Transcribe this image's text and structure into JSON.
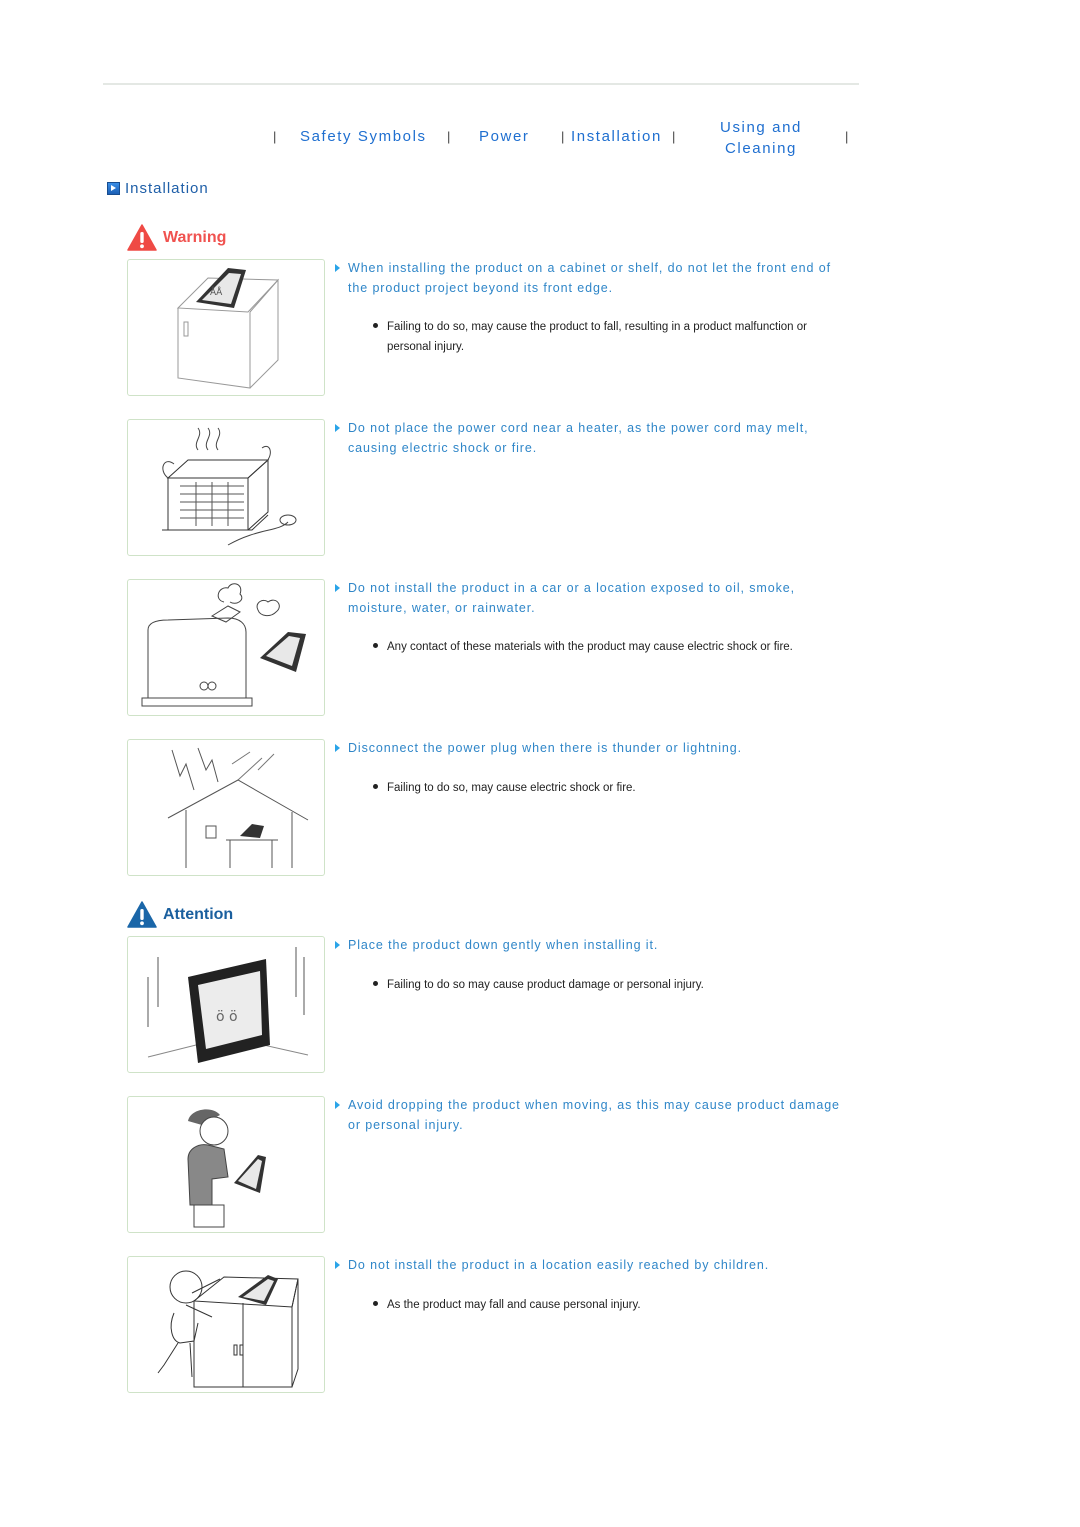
{
  "nav": {
    "items": [
      {
        "label": "Safety Symbols"
      },
      {
        "label": "Power"
      },
      {
        "label": "Installation"
      },
      {
        "label_line1": "Using and",
        "label_line2": "Cleaning"
      }
    ],
    "separator": "|"
  },
  "section": {
    "title": "Installation"
  },
  "warning": {
    "label": "Warning",
    "items": [
      {
        "heading": "When installing the product on a cabinet or shelf, do not let the front end of the product project beyond its front edge.",
        "bullet": "Failing to do so, may cause the product to fall, resulting in a product malfunction or personal injury.",
        "illustration": "photo-frame-on-cabinet-edge"
      },
      {
        "heading": "Do not place the power cord near a heater, as the power cord may melt, causing electric shock or fire.",
        "bullet": null,
        "illustration": "heater-with-power-cord"
      },
      {
        "heading": "Do not install the product in a car or a location exposed to oil, smoke, moisture, water, or rainwater.",
        "bullet": "Any contact of these materials with the product may cause electric shock or fire.",
        "illustration": "humidifier-steam-near-frame"
      },
      {
        "heading": "Disconnect the power plug when there is thunder or lightning.",
        "bullet": "Failing to do so, may cause electric shock or fire.",
        "illustration": "lightning-over-house"
      }
    ]
  },
  "attention": {
    "label": "Attention",
    "items": [
      {
        "heading": "Place the product down gently when installing it.",
        "bullet": "Failing to do so may cause product damage or personal injury.",
        "illustration": "frame-dropped-impact"
      },
      {
        "heading": "Avoid dropping the product when moving, as this may cause product damage or personal injury.",
        "bullet": null,
        "illustration": "person-carrying-frame"
      },
      {
        "heading": "Do not install the product in a location easily reached by children.",
        "bullet": "As the product may fall and cause personal injury.",
        "illustration": "baby-reaching-cabinet"
      }
    ]
  },
  "colors": {
    "nav_link": "#1f6fd0",
    "heading_text": "#2f86c8",
    "warning_red": "#f0524f",
    "attention_blue": "#1a5f9e",
    "image_border": "#cfe3c8"
  }
}
